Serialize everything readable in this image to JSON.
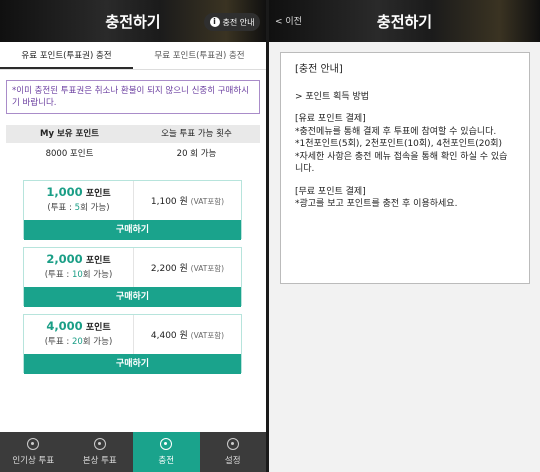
{
  "left": {
    "title": "충전하기",
    "guide_button": "충전 안내",
    "tabs": [
      "유료 포인트(투표권) 충전",
      "무료 포인트(투표권) 충전"
    ],
    "notice": "*이미 충전된 투표권은 취소나 환불이 되지 않으니 신중히 구매하시기 바랍니다.",
    "balance": {
      "headers": [
        "My 보유 포인트",
        "오늘 투표 가능 횟수"
      ],
      "values": [
        "8000 포인트",
        "20 회 가능"
      ]
    },
    "packages": [
      {
        "points": "1,000",
        "points_unit": "포인트",
        "votes_prefix": "(투표 : ",
        "votes": "5",
        "votes_suffix": "회 가능)",
        "price": "1,100 원",
        "vat": "(VAT포함)",
        "buy": "구매하기"
      },
      {
        "points": "2,000",
        "points_unit": "포인트",
        "votes_prefix": "(투표 : ",
        "votes": "10",
        "votes_suffix": "회 가능)",
        "price": "2,200 원",
        "vat": "(VAT포함)",
        "buy": "구매하기"
      },
      {
        "points": "4,000",
        "points_unit": "포인트",
        "votes_prefix": "(투표 : ",
        "votes": "20",
        "votes_suffix": "회 가능)",
        "price": "4,400 원",
        "vat": "(VAT포함)",
        "buy": "구매하기"
      }
    ],
    "nav": [
      "인기상 투표",
      "본상 투표",
      "충전",
      "설정"
    ]
  },
  "right": {
    "back": "< 이전",
    "title": "충전하기",
    "heading": "[충전 안내]",
    "section1": "> 포인트 획득 방법",
    "section2": "[유료 포인트 결제]\n*충전메뉴를 통해 결제 후 투표에 참여할 수 있습니다.\n*1천포인트(5회), 2천포인트(10회), 4천포인트(20회)\n*자세한 사항은 충전 메뉴 접속을 통해 확인 하실 수 있습니다.",
    "section3": "[무료 포인트 결제]\n*광고를 보고 포인트를 충전 후 이용하세요."
  },
  "colors": {
    "accent": "#1aa38c",
    "notice": "#6b3fa0"
  }
}
